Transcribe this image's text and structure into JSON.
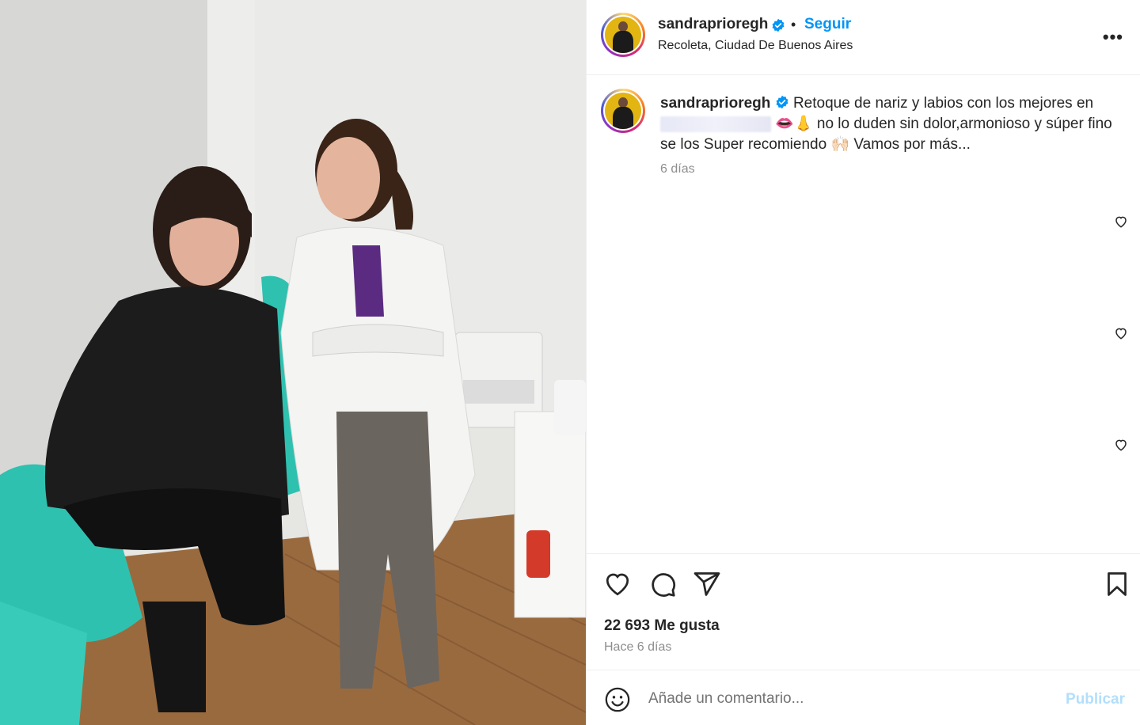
{
  "post": {
    "username": "sandrapriorегh",
    "location": "Recoleta, Ciudad De Buenos Aires",
    "follow_label": "Seguir",
    "separator": "•",
    "more_label": "•••"
  },
  "caption": {
    "username": "sandrapriorегh",
    "text_part1": "Retoque de nariz y labios con los mejores en",
    "emojis": "👄👃",
    "text_part2": "no lo duden sin dolor,armonioso y súper fino se los Super recomiendo",
    "emoji2": "🙌🏻",
    "text_part3": "Vamos por más...",
    "time": "6 días"
  },
  "stats": {
    "likes": "22 693 Me gusta",
    "posted": "Hace 6 días"
  },
  "comment": {
    "placeholder": "Añade un comentario...",
    "publish_label": "Publicar"
  },
  "colors": {
    "accent": "#0095f6",
    "publish_disabled": "#b2dffc",
    "verified": "#0095f6"
  },
  "icons": [
    "heart-icon",
    "comment-icon",
    "share-icon",
    "bookmark-icon",
    "emoji-icon",
    "more-icon",
    "verified-icon"
  ]
}
